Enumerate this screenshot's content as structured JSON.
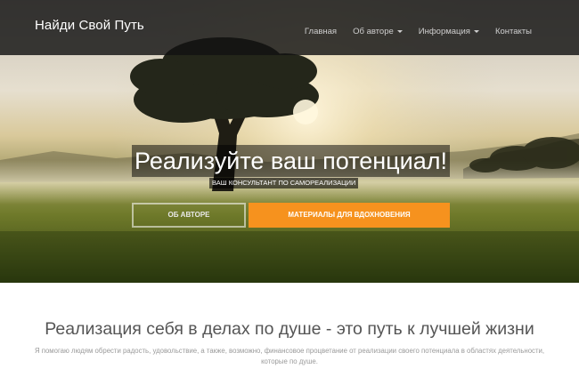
{
  "navbar": {
    "brand": "Найди Свой Путь",
    "items": [
      {
        "label": "Главная",
        "dropdown": false
      },
      {
        "label": "Об авторе",
        "dropdown": true
      },
      {
        "label": "Информация",
        "dropdown": true
      },
      {
        "label": "Контакты",
        "dropdown": false
      }
    ]
  },
  "hero": {
    "title": "Реализуйте ваш потенциал!",
    "subtitle": "ВАШ КОНСУЛЬТАНТ ПО САМОРЕАЛИЗАЦИИ",
    "button_about": "ОБ АВТОРЕ",
    "button_materials": "МАТЕРИАЛЫ ДЛЯ ВДОХНОВЕНИЯ"
  },
  "content": {
    "heading": "Реализация себя в делах по душе - это путь к лучшей жизни",
    "text": "Я помогаю людям обрести радость, удовольствие, а также, возможно, финансовое процветание от реализации своего потенциала в областях деятельности, которые по душе."
  },
  "colors": {
    "accent": "#f6921e",
    "navbar_bg": "#121212",
    "heading": "#555555",
    "body_text": "#9a9a9a"
  }
}
